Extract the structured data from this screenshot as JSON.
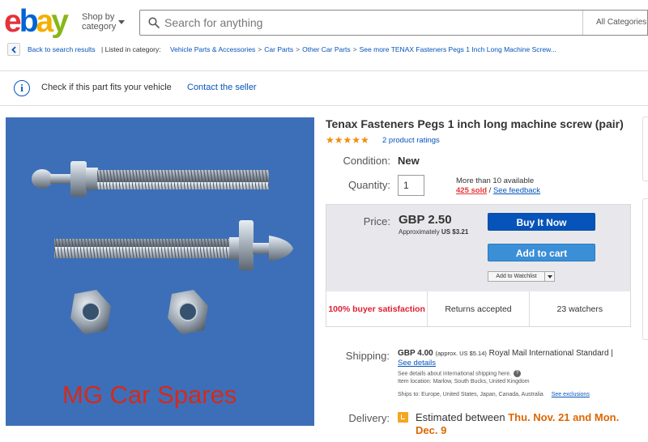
{
  "header": {
    "logo_letters": [
      "e",
      "b",
      "a",
      "y"
    ],
    "shop_by_category": [
      "Shop by",
      "category"
    ],
    "search_placeholder": "Search for anything",
    "category_select": "All Categories"
  },
  "breadcrumb": {
    "back_label": "Back to search results",
    "listed_in": "| Listed in category:",
    "items": [
      "Vehicle Parts & Accessories",
      "Car Parts",
      "Other Car Parts",
      "See more TENAX Fasteners Pegs 1 Inch Long Machine Screw..."
    ],
    "separator": ">"
  },
  "fit_notice": {
    "icon": "info-icon",
    "text": "Check if this part fits your vehicle",
    "contact": "Contact the seller"
  },
  "product": {
    "image_watermark": "MG Car Spares",
    "title": "Tenax Fasteners Pegs 1 inch long machine screw (pair)",
    "stars": "★★★★★",
    "rating_value": 5,
    "ratings_link": "2 product ratings",
    "condition_label": "Condition:",
    "condition_value": "New",
    "quantity_label": "Quantity:",
    "quantity_value": "1",
    "availability": "More than 10 available",
    "sold": "425 sold",
    "availability_sep": "/",
    "feedback": "See feedback"
  },
  "purchase": {
    "price_label": "Price:",
    "price": "GBP 2.50",
    "approx_prefix": "Approximately",
    "approx_value": "US $3.21",
    "buy_now": "Buy It Now",
    "add_to_cart": "Add to cart",
    "watchlist": "Add to Watchlist",
    "stats": [
      "100% buyer satisfaction",
      "Returns accepted",
      "23 watchers"
    ]
  },
  "shipping": {
    "label": "Shipping:",
    "cost": "GBP 4.00",
    "approx": "(approx. US $5.14)",
    "service": "Royal Mail International Standard |",
    "details_link": "See details",
    "note": "See details about international shipping here.",
    "location": "Item location:  Marlow, South Bucks, United Kingdom",
    "ships_to": "Ships to:  Europe, United States, Japan, Canada, Australia",
    "exclusions": "See exclusions"
  },
  "delivery": {
    "label": "Delivery:",
    "text": "Estimated between",
    "date": "Thu. Nov. 21 and Mon. Dec. 9"
  },
  "colors": {
    "logo_red": "#e53238",
    "logo_blue": "#0654ba",
    "logo_yellow": "#f5af02",
    "logo_green": "#86b817",
    "link": "#0654ba",
    "buy_button": "#0654ba",
    "cart_button": "#3b8fd6",
    "delivery_date": "#dd6600",
    "image_background": "#3d6fb8"
  }
}
